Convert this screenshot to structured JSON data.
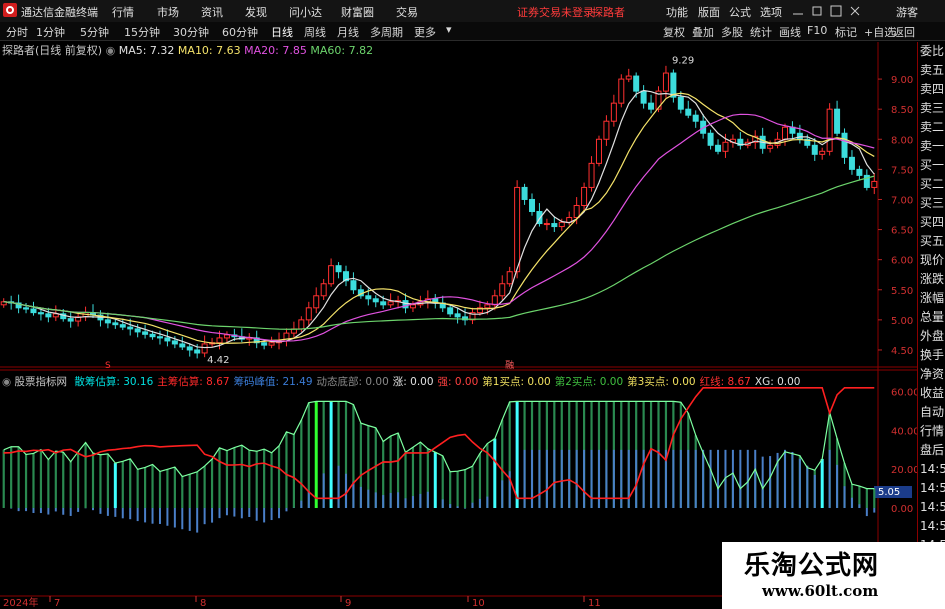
{
  "window": {
    "app_name": "通达信金融终端",
    "menus": [
      "行情",
      "市场",
      "资讯",
      "发现",
      "问小达",
      "财富圈",
      "交易"
    ],
    "login_notice": "证券交易未登录",
    "user": "探路者",
    "right_menus": [
      "功能",
      "版面",
      "公式",
      "选项"
    ],
    "guest": "游客"
  },
  "toolbar": {
    "periods": [
      "分时",
      "1分钟",
      "5分钟",
      "15分钟",
      "30分钟",
      "60分钟",
      "日线",
      "周线",
      "月线",
      "多周期",
      "更多"
    ],
    "right_buttons": [
      "复权",
      "叠加",
      "多股",
      "统计",
      "画线",
      "F10",
      "标记",
      "+自选",
      "返回"
    ]
  },
  "main_chart": {
    "stock_label": "探路者(日线 前复权)",
    "ma5_label": "MA5: 7.32",
    "ma10_label": "MA10: 7.63",
    "ma20_label": "MA20: 7.85",
    "ma60_label": "MA60: 7.82",
    "high_label": "9.29",
    "low_label": "4.42",
    "y_ticks": [
      "9.00",
      "8.50",
      "8.00",
      "7.50",
      "7.00",
      "6.50",
      "6.00",
      "5.50",
      "5.00",
      "4.50"
    ],
    "markers": [
      "S",
      "融",
      "财"
    ]
  },
  "indicator": {
    "name": "股票指标网",
    "items": [
      {
        "label": "散筹估算: 30.16",
        "color": "#00e0e0"
      },
      {
        "label": "主筹估算: 8.67",
        "color": "#ff2a2a"
      },
      {
        "label": "筹码峰值: 21.49",
        "color": "#3a7bd5"
      },
      {
        "label": "动态底部: 0.00",
        "color": "#888888"
      },
      {
        "label": "涨: 0.00",
        "color": "#e0e0e0"
      },
      {
        "label": "强: 0.00",
        "color": "#ff4040"
      },
      {
        "label": "第1买点: 0.00",
        "color": "#f0e060"
      },
      {
        "label": "第2买点: 0.00",
        "color": "#40c040"
      },
      {
        "label": "第3买点: 0.00",
        "color": "#f0e060"
      },
      {
        "label": "红线: 8.67",
        "color": "#ff3030"
      },
      {
        "label": "XG: 0.00",
        "color": "#e0e0e0"
      }
    ],
    "y_ticks": [
      "60.00",
      "40.00",
      "20.00",
      "0.00"
    ],
    "current_value": "5.05"
  },
  "x_axis": [
    "2024年",
    "7",
    "8",
    "9",
    "10",
    "11"
  ],
  "right_panel": [
    "委比",
    "卖五",
    "卖四",
    "卖三",
    "卖二",
    "卖一",
    "买一",
    "买二",
    "买三",
    "买四",
    "买五",
    "现价",
    "涨跌",
    "涨幅",
    "总量",
    "外盘",
    "换手",
    "净资",
    "收益",
    "自动",
    "行情",
    "盘后",
    "14:50",
    "14:50",
    "14:50",
    "14:50",
    "14:50",
    "14:50"
  ],
  "watermark": {
    "title": "乐淘公式网",
    "url": "www.60lt.com"
  },
  "chart_data": {
    "type": "candlestick",
    "title": "探路者(日线 前复权)",
    "ylim": [
      4.3,
      9.4
    ],
    "closes": [
      5.3,
      5.28,
      5.2,
      5.18,
      5.12,
      5.1,
      5.05,
      5.1,
      5.02,
      4.98,
      5.05,
      5.12,
      5.08,
      5.0,
      4.95,
      4.92,
      4.88,
      4.85,
      4.8,
      4.76,
      4.72,
      4.7,
      4.65,
      4.6,
      4.55,
      4.5,
      4.45,
      4.6,
      4.62,
      4.7,
      4.75,
      4.72,
      4.68,
      4.7,
      4.62,
      4.58,
      4.62,
      4.65,
      4.78,
      4.85,
      5.0,
      5.2,
      5.4,
      5.6,
      5.9,
      5.8,
      5.65,
      5.5,
      5.4,
      5.35,
      5.3,
      5.25,
      5.3,
      5.32,
      5.2,
      5.25,
      5.3,
      5.35,
      5.28,
      5.2,
      5.1,
      5.05,
      5.0,
      5.12,
      5.2,
      5.25,
      5.4,
      5.6,
      5.8,
      7.2,
      7.0,
      6.8,
      6.6,
      6.6,
      6.55,
      6.62,
      6.7,
      6.9,
      7.2,
      7.6,
      8.0,
      8.3,
      8.6,
      9.0,
      9.05,
      8.8,
      8.6,
      8.5,
      8.8,
      9.1,
      8.7,
      8.5,
      8.4,
      8.3,
      8.1,
      7.9,
      7.8,
      7.95,
      8.0,
      7.9,
      7.95,
      8.05,
      7.85,
      7.9,
      8.0,
      8.2,
      8.1,
      8.0,
      7.9,
      7.75,
      7.8,
      8.5,
      8.1,
      7.7,
      7.5,
      7.4,
      7.2,
      7.3
    ],
    "ma_values": {
      "MA5": 7.32,
      "MA10": 7.63,
      "MA20": 7.85,
      "MA60": 7.82
    },
    "high": 9.29,
    "low": 4.42
  }
}
